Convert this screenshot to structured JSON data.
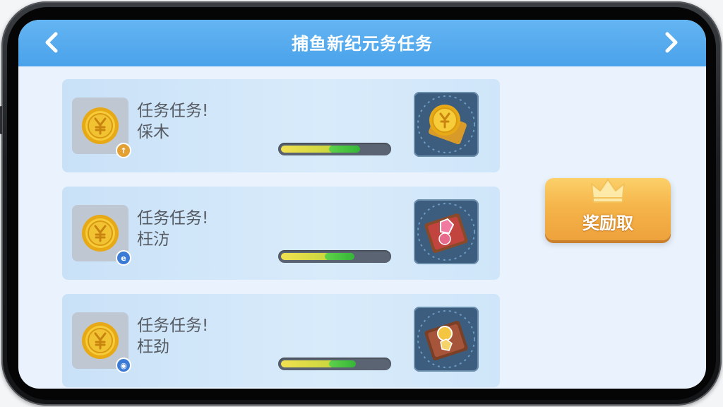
{
  "header": {
    "title": "捕鱼新纪元务任务",
    "prev_icon": "chevron-left-icon",
    "next_icon": "chevron-right-icon"
  },
  "tasks": [
    {
      "line1": "任务任务!",
      "line2": "倸木",
      "badge_symbol": "↑",
      "badge_color": "#e3a033",
      "progress_yellow": 0.5,
      "progress_green": 0.75,
      "reward_icon": "gold-coin-ticket-icon"
    },
    {
      "line1": "任务任务!",
      "line2": "枉汸",
      "badge_symbol": "e",
      "badge_color": "#3b7bd6",
      "progress_yellow": 0.45,
      "progress_green": 0.68,
      "reward_icon": "red-gem-ticket-icon"
    },
    {
      "line1": "任务任务!",
      "line2": "枉劲",
      "badge_symbol": "◉",
      "badge_color": "#3b7bd6",
      "progress_yellow": 0.5,
      "progress_green": 0.7,
      "reward_icon": "gold-gem-ticket-icon"
    }
  ],
  "claim_button": {
    "label": "奖励取",
    "icon": "crown-icon"
  },
  "colors": {
    "header_blue": "#4aa2ea",
    "button_orange": "#f5b54a",
    "coin_gold": "#f1c232"
  }
}
